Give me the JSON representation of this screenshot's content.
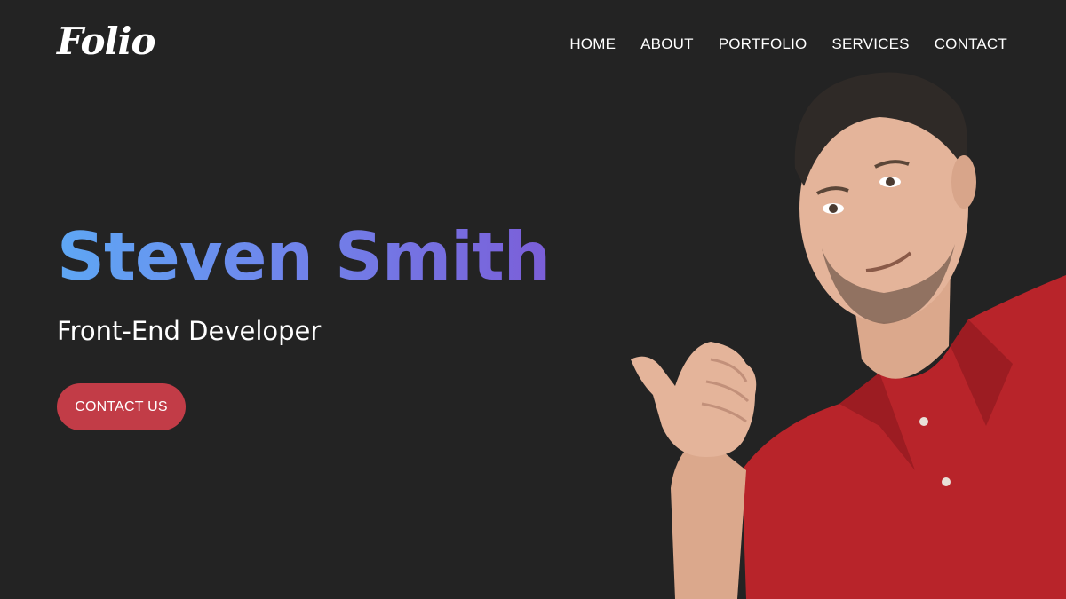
{
  "brand": {
    "logo": "Folio"
  },
  "nav": {
    "items": [
      {
        "label": "HOME"
      },
      {
        "label": "ABOUT"
      },
      {
        "label": "PORTFOLIO"
      },
      {
        "label": "SERVICES"
      },
      {
        "label": "CONTACT"
      }
    ]
  },
  "hero": {
    "name": "Steven Smith",
    "role": "Front-End Developer",
    "cta_label": "CONTACT US"
  },
  "colors": {
    "background": "#232323",
    "gradient_start": "#5ea7f4",
    "gradient_end": "#7b5ed8",
    "button": "#c23c47",
    "shirt": "#b8242a"
  }
}
